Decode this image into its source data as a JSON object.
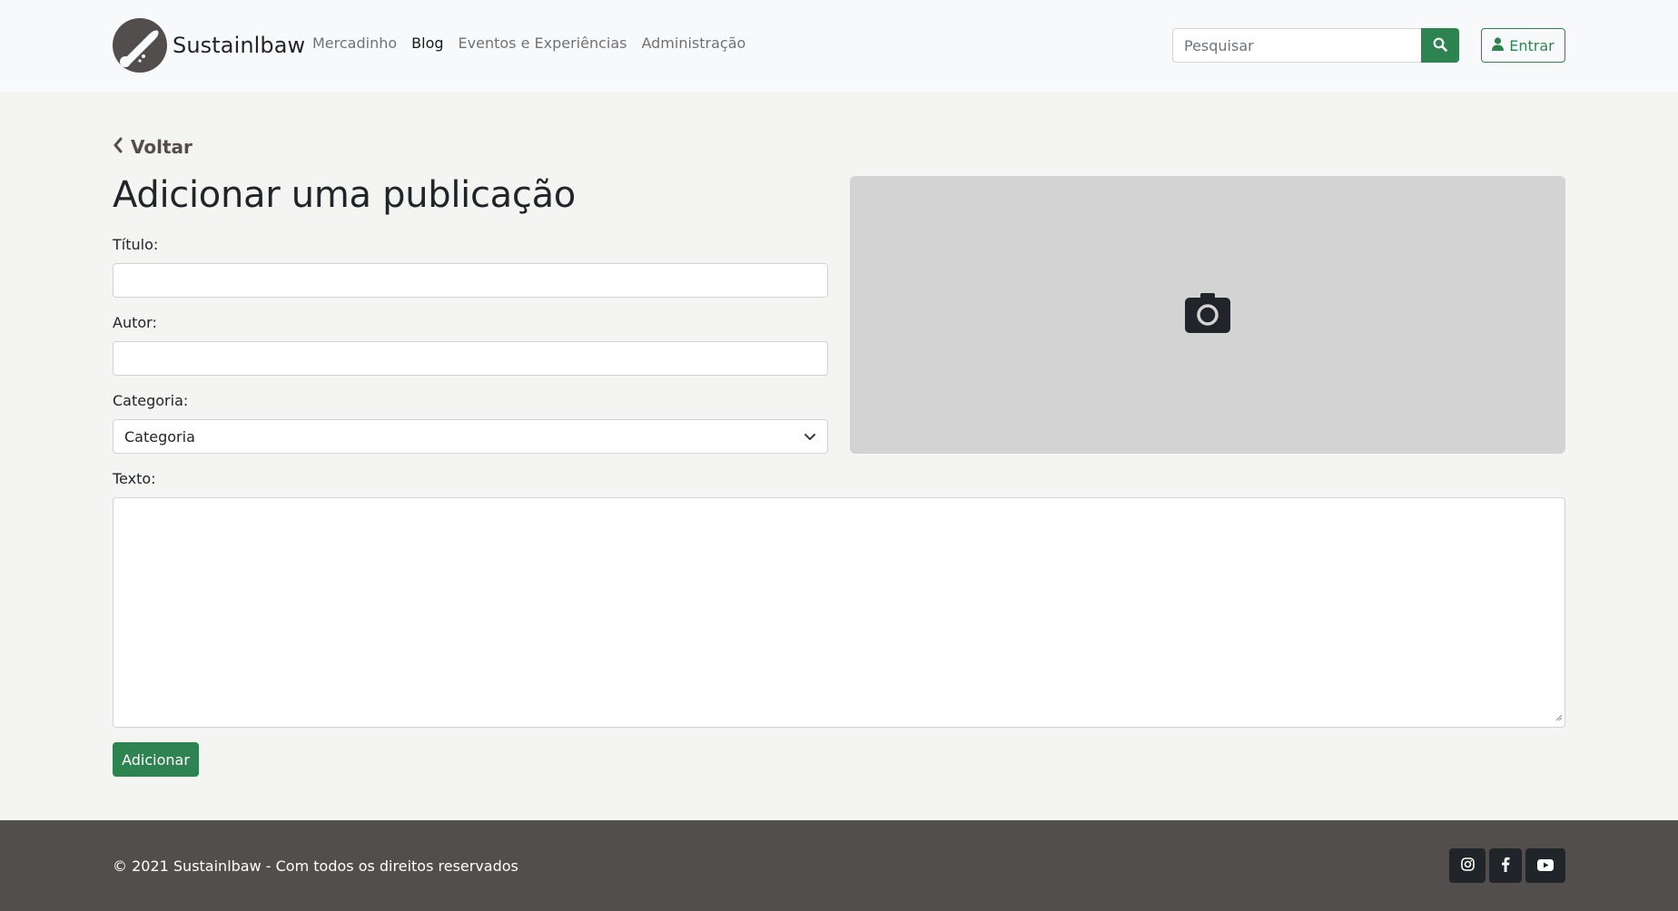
{
  "navbar": {
    "brand": "Sustainlbaw",
    "links": [
      {
        "label": "Mercadinho",
        "active": false
      },
      {
        "label": "Blog",
        "active": true
      },
      {
        "label": "Eventos e Experiências",
        "active": false
      },
      {
        "label": "Administração",
        "active": false
      }
    ],
    "search_placeholder": "Pesquisar",
    "search_icon": "search-icon",
    "login_label": "Entrar",
    "login_icon": "user-icon"
  },
  "main": {
    "back_label": "Voltar",
    "title": "Adicionar uma publicação",
    "form": {
      "title_label": "Título:",
      "title_value": "",
      "author_label": "Autor:",
      "author_value": "",
      "category_label": "Categoria:",
      "category_selected": "Categoria",
      "text_label": "Texto:",
      "text_value": "",
      "submit_label": "Adicionar"
    },
    "image_upload_icon": "camera-icon"
  },
  "footer": {
    "copyright": "© 2021 Sustainlbaw - Com todos os direitos reservados",
    "social": [
      "instagram-icon",
      "facebook-icon",
      "youtube-icon"
    ]
  },
  "colors": {
    "primary_green": "#2e8450",
    "dark_brown": "#534e4e",
    "page_bg": "#f4f4f2",
    "image_placeholder_bg": "#d3d3d3"
  }
}
